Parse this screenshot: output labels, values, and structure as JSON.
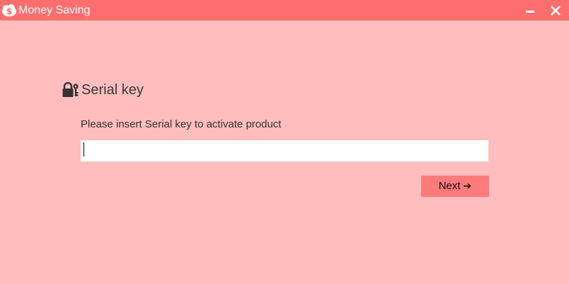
{
  "window": {
    "title": "Money Saving",
    "icon": "money-cloud-icon",
    "minimize_icon": "minimize-icon",
    "close_icon": "close-icon"
  },
  "main": {
    "heading": "Serial key",
    "heading_icon": "lock-key-icon",
    "instruction": "Please insert Serial key to activate product",
    "serial_input": {
      "value": "",
      "placeholder": ""
    },
    "next_button": {
      "label": "Next",
      "icon": "arrow-right-icon",
      "arrow_glyph": "➔"
    }
  },
  "colors": {
    "titlebar": "#ff6e6e",
    "background": "#ffbdbd",
    "button": "#ff7a7a",
    "input": "#ffffff"
  }
}
